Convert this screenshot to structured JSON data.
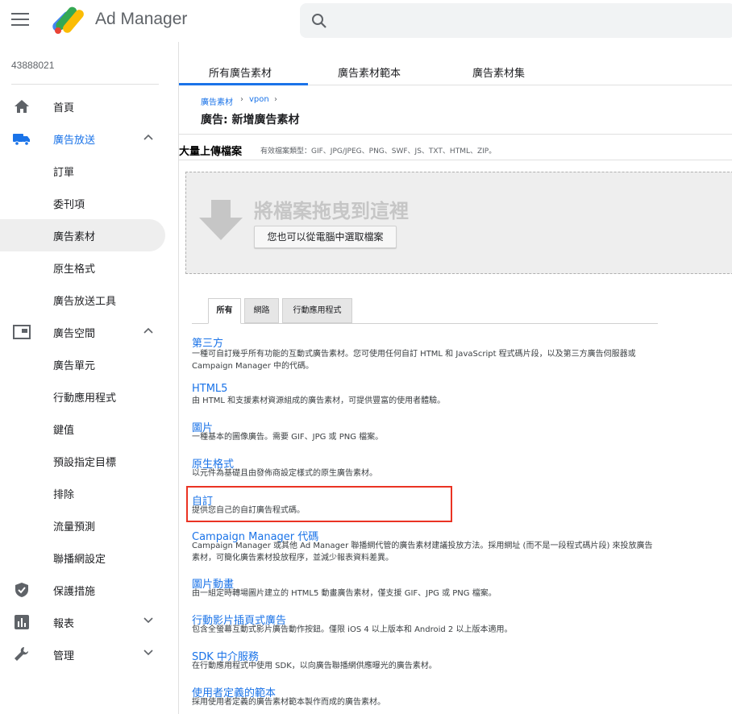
{
  "header": {
    "app_title": "Ad Manager",
    "menu_icon": "hamburger-menu-icon",
    "search_icon": "search-icon"
  },
  "sidebar": {
    "network_id": "43888021",
    "items": [
      {
        "label": "首頁",
        "icon": "home-icon"
      },
      {
        "label": "廣告放送",
        "icon": "truck-icon",
        "expanded": true
      },
      {
        "label": "訂單"
      },
      {
        "label": "委刊項"
      },
      {
        "label": "廣告素材",
        "selected": true
      },
      {
        "label": "原生格式"
      },
      {
        "label": "廣告放送工具"
      },
      {
        "label": "廣告空間",
        "icon": "inventory-icon",
        "expanded": true
      },
      {
        "label": "廣告單元"
      },
      {
        "label": "行動應用程式"
      },
      {
        "label": "鍵值"
      },
      {
        "label": "預設指定目標"
      },
      {
        "label": "排除"
      },
      {
        "label": "流量預測"
      },
      {
        "label": "聯播網設定"
      },
      {
        "label": "保護措施",
        "icon": "shield-icon"
      },
      {
        "label": "報表",
        "icon": "bar-chart-icon",
        "expanded": false
      },
      {
        "label": "管理",
        "icon": "wrench-icon",
        "expanded": false
      }
    ]
  },
  "main": {
    "tabs": [
      "所有廣告素材",
      "廣告素材範本",
      "廣告素材集"
    ],
    "active_tab": 0,
    "breadcrumb": [
      "廣告素材",
      "vpon"
    ],
    "page_title": "廣告: 新增廣告素材",
    "upload": {
      "title": "大量上傳檔案",
      "types": "有效檔案類型：GIF、JPG/JPEG、PNG、SWF、JS、TXT、HTML、ZIP。",
      "drop_text": "將檔案拖曳到這裡",
      "choose_button": "您也可以從電腦中選取檔案"
    },
    "filter_tabs": [
      "所有",
      "網路",
      "行動應用程式"
    ],
    "active_filter": 0,
    "options": [
      {
        "title": "第三方",
        "desc": "一種可自訂幾乎所有功能的互動式廣告素材。您可使用任何自訂 HTML 和 JavaScript 程式碼片段，以及第三方廣告伺服器或 Campaign Manager 中的代碼。"
      },
      {
        "title": "HTML5",
        "desc": "由 HTML 和支援素材資源組成的廣告素材，可提供豐富的使用者體驗。"
      },
      {
        "title": "圖片",
        "desc": "一種基本的圖像廣告。需要 GIF、JPG 或 PNG 檔案。"
      },
      {
        "title": "原生格式",
        "desc": "以元件為基礎且由發佈商設定樣式的原生廣告素材。"
      },
      {
        "title": "自訂",
        "desc": "提供您自己的自訂廣告程式碼。",
        "highlighted": true
      },
      {
        "title": "Campaign Manager 代碼",
        "desc": "Campaign Manager 或其他 Ad Manager 聯播網代管的廣告素材建議投放方法。採用網址 (而不是一段程式碼片段) 來投放廣告素材，可簡化廣告素材投放程序，並減少報表資料差異。"
      },
      {
        "title": "圖片動畫",
        "desc": "由一組定時轉場圖片建立的 HTML5 動畫廣告素材，僅支援 GIF、JPG 或 PNG 檔案。"
      },
      {
        "title": "行動影片插頁式廣告",
        "desc": "包含全螢幕互動式影片廣告動作按鈕。僅限 iOS 4 以上版本和 Android 2 以上版本適用。"
      },
      {
        "title": "SDK 中介服務",
        "desc": "在行動應用程式中使用 SDK，以向廣告聯播網供應曝光的廣告素材。"
      },
      {
        "title": "使用者定義的範本",
        "desc": "採用使用者定義的廣告素材範本製作而成的廣告素材。"
      }
    ]
  },
  "colors": {
    "accent": "#1a73e8",
    "highlight_border": "#ea3323"
  }
}
